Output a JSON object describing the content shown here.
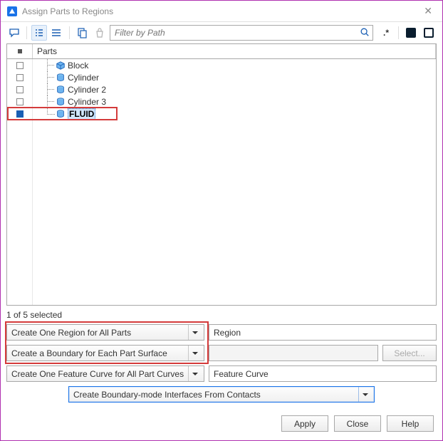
{
  "window": {
    "title": "Assign Parts to Regions"
  },
  "filter": {
    "placeholder": "Filter by Path"
  },
  "parts_header": "Parts",
  "parts": [
    {
      "name": "Block",
      "checked": false,
      "selected": false
    },
    {
      "name": "Cylinder",
      "checked": false,
      "selected": false
    },
    {
      "name": "Cylinder 2",
      "checked": false,
      "selected": false
    },
    {
      "name": "Cylinder 3",
      "checked": false,
      "selected": false
    },
    {
      "name": "FLUID",
      "checked": true,
      "selected": true
    }
  ],
  "status": "1 of 5 selected",
  "options": {
    "region_mode": {
      "label": "Create One Region for All Parts",
      "name_field": "Region",
      "name_enabled": true
    },
    "boundary_mode": {
      "label": "Create a Boundary for Each Part Surface",
      "name_field": "",
      "name_enabled": false,
      "select_btn": "Select...",
      "select_enabled": false
    },
    "curve_mode": {
      "label": "Create One Feature Curve for All Part Curves",
      "name_field": "Feature Curve",
      "name_enabled": true
    },
    "interface_mode": {
      "label": "Create Boundary-mode Interfaces From Contacts"
    }
  },
  "buttons": {
    "apply": "Apply",
    "close": "Close",
    "help": "Help"
  }
}
